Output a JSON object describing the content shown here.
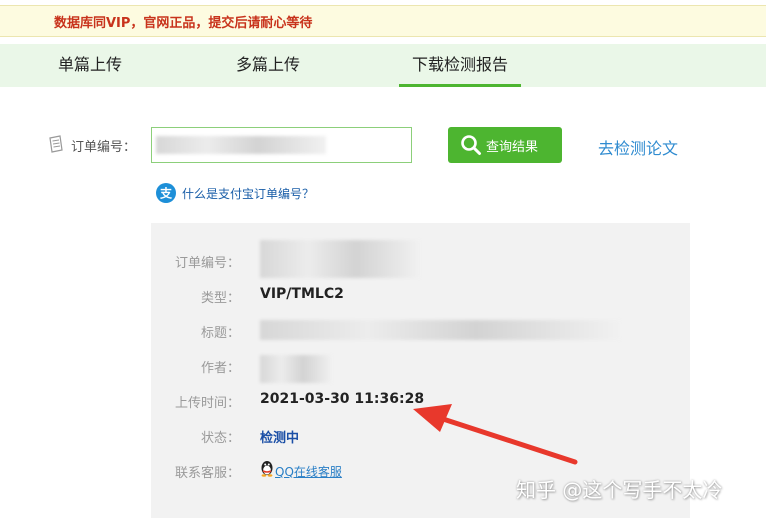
{
  "notice": "数据库同VIP，官网正品，提交后请耐心等待",
  "tabs": [
    {
      "label": "单篇上传",
      "active": false
    },
    {
      "label": "多篇上传",
      "active": false
    },
    {
      "label": "下载检测报告",
      "active": true
    }
  ],
  "search": {
    "order_label": "订单编号：",
    "query_button": "查询结果",
    "go_check_link": "去检测论文",
    "alipay_help": "什么是支付宝订单编号？"
  },
  "result": {
    "order_no_label": "订单编号：",
    "type_label": "类型：",
    "type_value": "VIP/TMLC2",
    "title_label": "标题：",
    "author_label": "作者：",
    "upload_time_label": "上传时间：",
    "upload_time_value": "2021-03-30 11:36:28",
    "status_label": "状态：",
    "status_value": "检测中",
    "support_label": "联系客服：",
    "support_link": "QQ在线客服"
  },
  "watermark": "知乎 @这个写手不太冷",
  "colors": {
    "accent_green": "#4db530",
    "notice_red": "#c8331c",
    "link_blue": "#2f8bd0",
    "annotation_red": "#e8382c"
  }
}
